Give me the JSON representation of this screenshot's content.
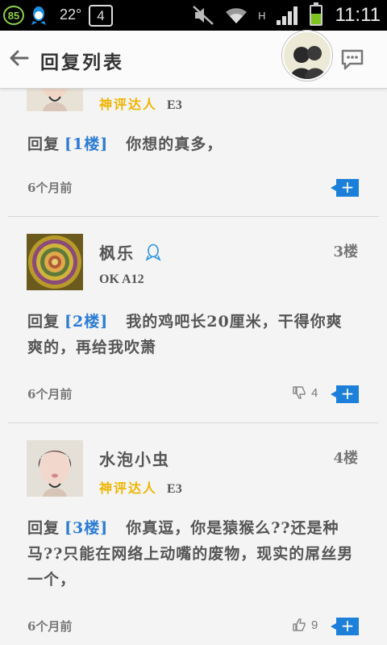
{
  "status_bar": {
    "badge": "85",
    "temperature": "22°",
    "notification_count": "4",
    "network_type": "H",
    "battery_level_percent": 60,
    "time": "11:11"
  },
  "header": {
    "title": "回复列表"
  },
  "replies": [
    {
      "medal": "神评达人",
      "level": "E3",
      "reply_word": "回复",
      "reply_to": "[1楼]",
      "text": "你想的真多，",
      "time": "6个月前"
    },
    {
      "username": "枫乐",
      "floor": "3楼",
      "level": "OK A12",
      "reply_word": "回复",
      "reply_to": "[2楼]",
      "text": "我的鸡吧长20厘米，干得你爽爽的，再给我吹萧",
      "time": "6个月前",
      "votes": "4"
    },
    {
      "username": "水泡小虫",
      "floor": "4楼",
      "medal": "神评达人",
      "level": "E3",
      "reply_word": "回复",
      "reply_to": "[3楼]",
      "text": "你真逗，你是猿猴么??还是种马??只能在网络上动嘴的废物，现实的屌丝男一个，",
      "time": "6个月前",
      "votes": "9"
    }
  ],
  "colors": {
    "accent": "#1c7fd9",
    "medal": "#f0b400",
    "link": "#2b7bd6"
  },
  "icons": [
    "back-arrow-icon",
    "chat-icon",
    "plus-icon",
    "thumbs-down-icon",
    "thumbs-up-icon",
    "qq-icon",
    "mute-icon",
    "wifi-icon",
    "signal-icon",
    "battery-icon"
  ]
}
